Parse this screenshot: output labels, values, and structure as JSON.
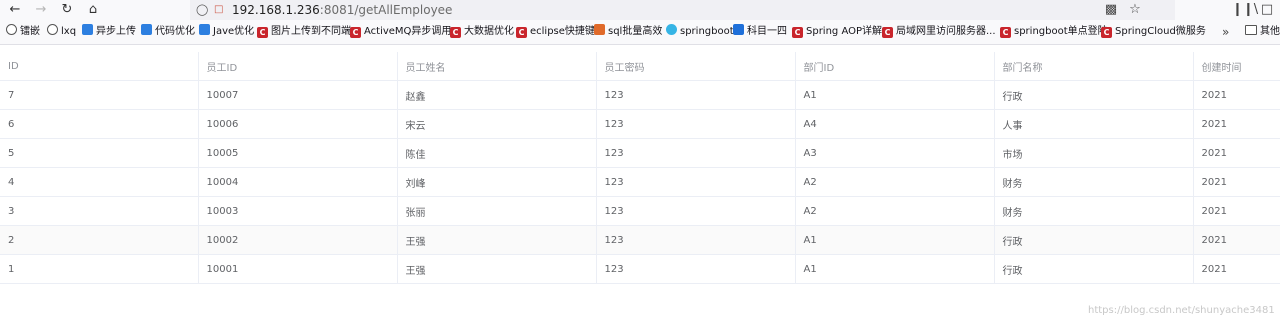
{
  "browser": {
    "url_host": "192.168.1.236",
    "url_path": ":8081/getAllEmployee"
  },
  "bookmarks": [
    {
      "label": "镭嵌",
      "icon": "globe-icon"
    },
    {
      "label": "lxq",
      "icon": "globe-icon"
    },
    {
      "label": "异步上传",
      "icon": "blue-logo-icon"
    },
    {
      "label": "代码优化",
      "icon": "blue-logo-icon"
    },
    {
      "label": "Jave优化",
      "icon": "blue-logo-icon"
    },
    {
      "label": "图片上传到不同端",
      "icon": "csdn-icon"
    },
    {
      "label": "ActiveMQ异步调用",
      "icon": "csdn-icon"
    },
    {
      "label": "大数据优化",
      "icon": "csdn-icon"
    },
    {
      "label": "eclipse快捷键",
      "icon": "csdn-icon"
    },
    {
      "label": "sql批量高效",
      "icon": "orange-logo-icon"
    },
    {
      "label": "springboot",
      "icon": "shield-logo-icon"
    },
    {
      "label": "科目一四",
      "icon": "car-icon"
    },
    {
      "label": "Spring AOP详解",
      "icon": "csdn-icon"
    },
    {
      "label": "局域网里访问服务器...",
      "icon": "csdn-icon"
    },
    {
      "label": "springboot单点登陆",
      "icon": "csdn-icon"
    },
    {
      "label": "SpringCloud微服务",
      "icon": "csdn-icon"
    },
    {
      "label": "其他书",
      "icon": "folder-icon"
    }
  ],
  "table": {
    "columns": [
      "ID",
      "员工ID",
      "员工姓名",
      "员工密码",
      "部门ID",
      "部门名称",
      "创建时间"
    ],
    "rows": [
      [
        "7",
        "10007",
        "赵鑫",
        "123",
        "A1",
        "行政",
        "2021"
      ],
      [
        "6",
        "10006",
        "宋云",
        "123",
        "A4",
        "人事",
        "2021"
      ],
      [
        "5",
        "10005",
        "陈佳",
        "123",
        "A3",
        "市场",
        "2021"
      ],
      [
        "4",
        "10004",
        "刘峰",
        "123",
        "A2",
        "财务",
        "2021"
      ],
      [
        "3",
        "10003",
        "张丽",
        "123",
        "A2",
        "财务",
        "2021"
      ],
      [
        "2",
        "10002",
        "王强",
        "123",
        "A1",
        "行政",
        "2021"
      ],
      [
        "1",
        "10001",
        "王强",
        "123",
        "A1",
        "行政",
        "2021"
      ]
    ]
  },
  "watermark": "https://blog.csdn.net/shunyache3481"
}
